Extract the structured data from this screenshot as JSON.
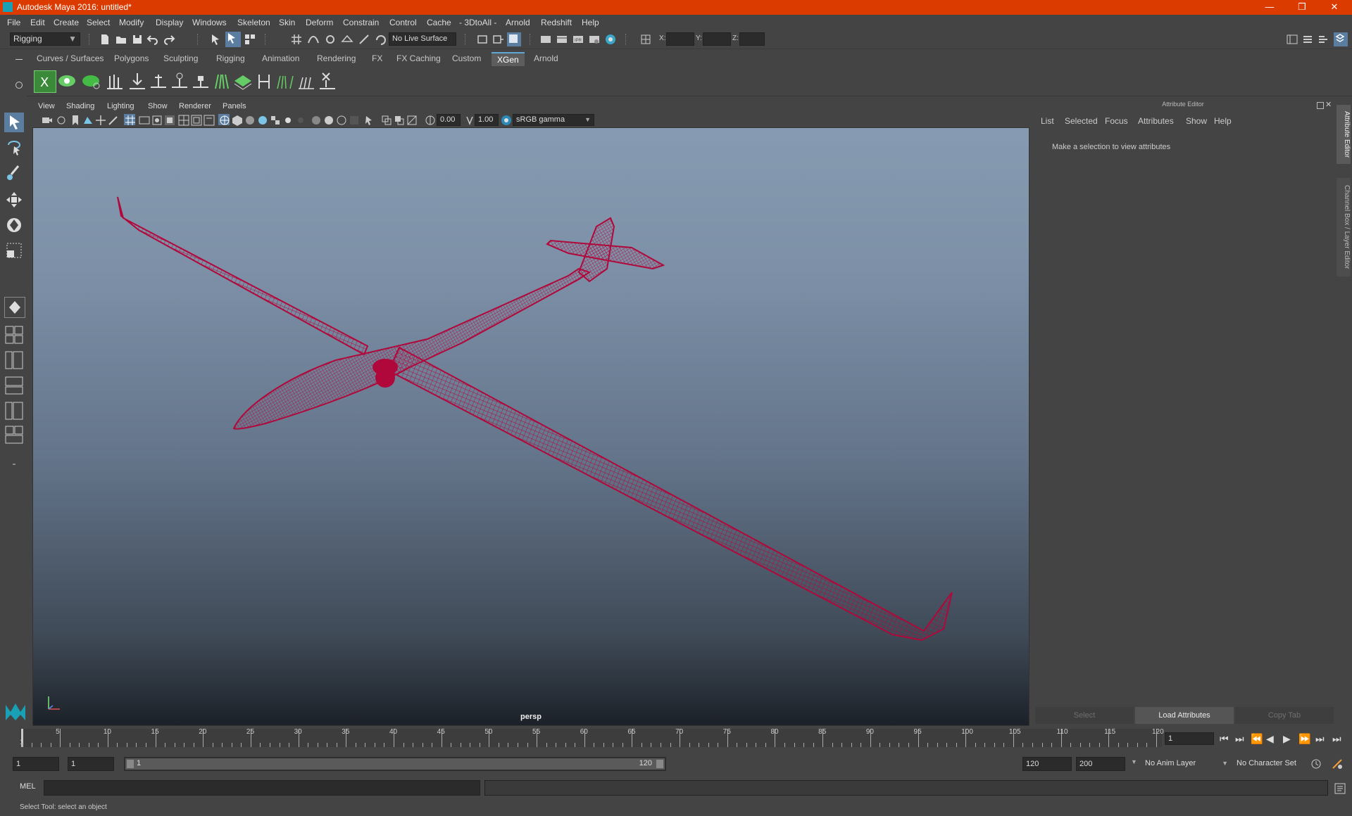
{
  "window": {
    "title": "Autodesk Maya 2016: untitled*",
    "minimize": "—",
    "restore": "❐",
    "close": "✕"
  },
  "menu": [
    "File",
    "Edit",
    "Create",
    "Select",
    "Modify",
    "Display",
    "Windows",
    "Skeleton",
    "Skin",
    "Deform",
    "Constrain",
    "Control",
    "Cache",
    "- 3DtoAll -",
    "Arnold",
    "Redshift",
    "Help"
  ],
  "status": {
    "menuset": "Rigging",
    "live_surface": "No Live Surface",
    "x_label": "X:",
    "y_label": "Y:",
    "z_label": "Z:"
  },
  "shelf_tabs": [
    "Curves / Surfaces",
    "Polygons",
    "Sculpting",
    "Rigging",
    "Animation",
    "Rendering",
    "FX",
    "FX Caching",
    "Custom",
    "XGen",
    "Arnold"
  ],
  "shelf_active": "XGen",
  "viewport": {
    "menu": [
      "View",
      "Shading",
      "Lighting",
      "Show",
      "Renderer",
      "Panels"
    ],
    "exposure": "0.00",
    "gamma": "1.00",
    "colorspace": "sRGB gamma",
    "camera_label": "persp",
    "wire_color": "#b0083a"
  },
  "attribute_editor": {
    "title": "Attribute Editor",
    "menu": [
      "List",
      "Selected",
      "Focus",
      "Attributes",
      "Show",
      "Help"
    ],
    "message": "Make a selection to view attributes",
    "buttons": [
      "Select",
      "Load Attributes",
      "Copy Tab"
    ]
  },
  "side_tabs": [
    "Attribute Editor",
    "Channel Box / Layer Editor"
  ],
  "timeline": {
    "ticks": [
      "5",
      "10",
      "15",
      "20",
      "25",
      "30",
      "35",
      "40",
      "45",
      "50",
      "55",
      "60",
      "65",
      "70",
      "75",
      "80",
      "85",
      "90",
      "95",
      "100",
      "105",
      "110",
      "115",
      "120"
    ],
    "start_label": "1",
    "current_frame": "1"
  },
  "range": {
    "start": "1",
    "playback_start": "1",
    "slider_start": "1",
    "slider_end": "120",
    "playback_end": "120",
    "end": "200",
    "anim_layer": "No Anim Layer",
    "char_set": "No Character Set"
  },
  "command": {
    "label": "MEL"
  },
  "helpline": "Select Tool: select an object"
}
